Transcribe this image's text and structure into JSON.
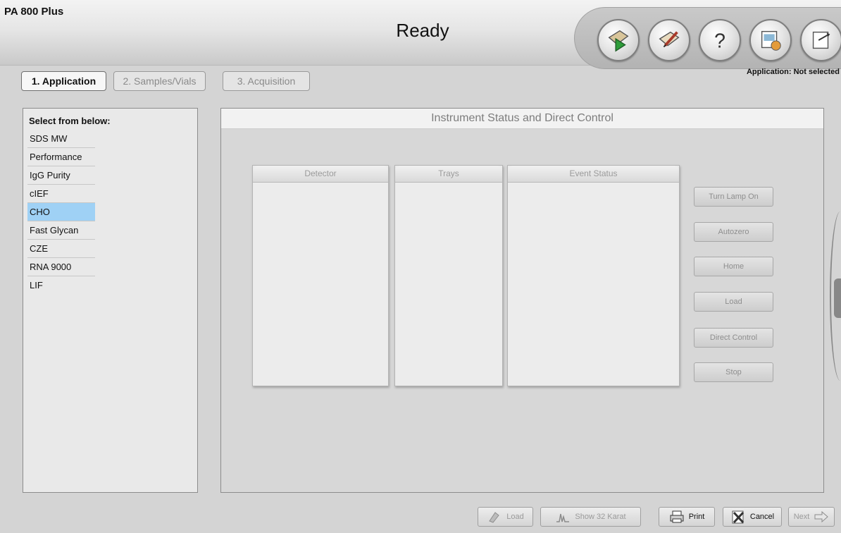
{
  "header": {
    "app_title": "PA 800 Plus",
    "status": "Ready",
    "application_status": "Application: Not selected"
  },
  "toolbar": {
    "icons": [
      "run-icon",
      "edit-method-icon",
      "help-icon",
      "gallery-icon",
      "exit-icon"
    ]
  },
  "tabs": [
    {
      "label": "1. Application",
      "active": true
    },
    {
      "label": "2. Samples/Vials",
      "active": false
    },
    {
      "label": "3. Acquisition",
      "active": false
    }
  ],
  "left_panel": {
    "title": "Select from below:",
    "items": [
      "SDS MW",
      "Performance",
      "IgG Purity",
      "cIEF",
      "CHO",
      "Fast Glycan",
      "CZE",
      "RNA 9000",
      "LIF"
    ],
    "selected": "CHO"
  },
  "main_panel": {
    "title": "Instrument Status and Direct Control",
    "panels": [
      "Detector",
      "Trays",
      "Event Status"
    ],
    "buttons": [
      "Turn Lamp On",
      "Autozero",
      "Home",
      "Load",
      "Direct Control",
      "Stop"
    ]
  },
  "bottom_bar": {
    "buttons": [
      "Load",
      "Show 32 Karat",
      "Print",
      "Cancel",
      "Next"
    ]
  },
  "colors": {
    "selected_item": "#9fd1f5",
    "background": "#d4d4d4"
  }
}
